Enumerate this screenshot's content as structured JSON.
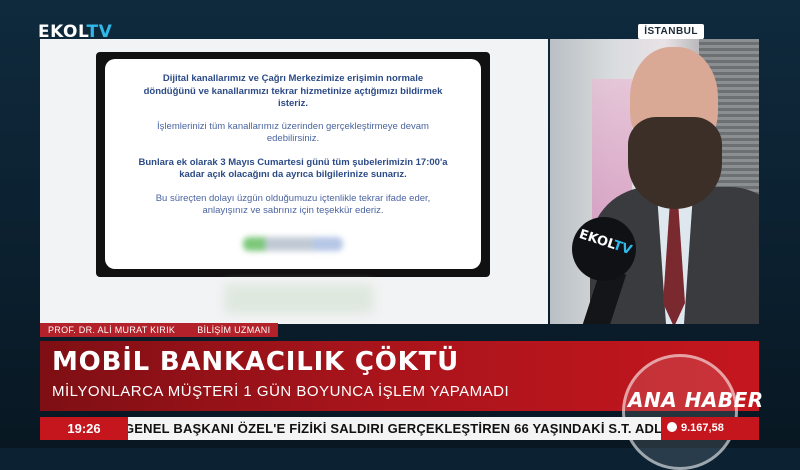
{
  "channel": {
    "logo_main": "EKOL",
    "logo_tv": "TV",
    "location": "İSTANBUL"
  },
  "document": {
    "paragraph1": "Dijital kanallarımız ve Çağrı Merkezimize erişimin normale döndüğünü ve kanallarımızı tekrar hizmetinize açtığımızı bildirmek isteriz.",
    "paragraph2": "İşlemlerinizi tüm kanallarımız üzerinden gerçekleştirmeye devam edebilirsiniz.",
    "paragraph3": "Bunlara ek olarak 3 Mayıs Cumartesi günü tüm şubelerimizin 17:00'a kadar açık olacağını da ayrıca bilgilerinize sunarız.",
    "paragraph4": "Bu süreçten dolayı üzgün olduğumuzu içtenlikle tekrar ifade eder, anlayışınız ve sabrınız için teşekkür ederiz."
  },
  "microphone": {
    "brand_main": "EKOL",
    "brand_tv": "TV"
  },
  "guest": {
    "name": "PROF. DR. ALİ MURAT KIRIK",
    "title": "BİLİŞİM UZMANI"
  },
  "headline": {
    "title": "MOBİL BANKACILIK ÇÖKTÜ",
    "subtitle": "MİLYONLARCA MÜŞTERİ 1 GÜN BOYUNCA İŞLEM YAPAMADI"
  },
  "program": {
    "name": "ANA HABER"
  },
  "ticker": {
    "time": "19:26",
    "text": "GENEL BAŞKANI ÖZEL'E FİZİKİ SALDIRI GERÇEKLEŞTİREN 66 YAŞINDAKİ S.T. ADLI ŞAHS",
    "market_value": "9.167,58"
  },
  "colors": {
    "accent": "#c5161e",
    "brand_blue": "#2fb8ea",
    "document_text": "#2c4b86"
  }
}
